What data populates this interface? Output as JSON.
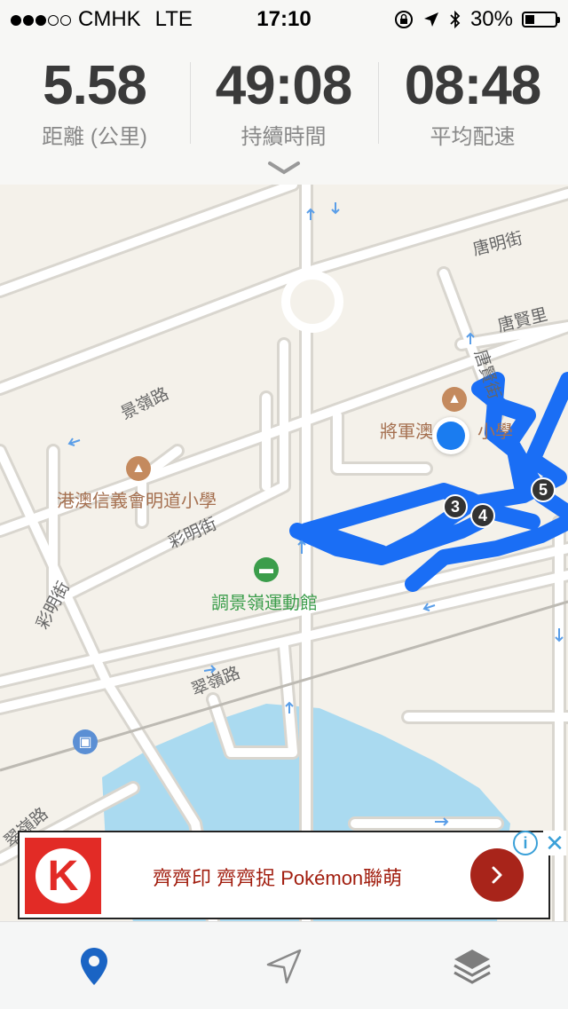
{
  "status_bar": {
    "carrier": "CMHK",
    "network": "LTE",
    "time": "17:10",
    "battery": "30%",
    "signal_dots_filled": 3,
    "signal_dots_total": 5
  },
  "stats": {
    "distance": {
      "value": "5.58",
      "label": "距離 (公里)"
    },
    "duration": {
      "value": "49:08",
      "label": "持續時間"
    },
    "pace": {
      "value": "08:48",
      "label": "平均配速"
    }
  },
  "map": {
    "pois": {
      "school_1": "將軍澳",
      "school_1b": "小學",
      "school_2": "港澳信義會明道小學",
      "sports_centre": "調景嶺運動館"
    },
    "roads": {
      "tong_ming": "唐明街",
      "tong_yin": "唐賢里",
      "tong_yin_st": "唐賢街",
      "king_ling": "景嶺路",
      "choi_ming": "彩明街",
      "choi_ming_2": "彩明街",
      "chui_ling": "翠嶺路",
      "chui_ling_2": "翠嶺路"
    },
    "markers": [
      "3",
      "4",
      "5"
    ],
    "route_color": "#1a6ef5",
    "water_color": "#aadaf0"
  },
  "ad": {
    "brand_letter": "K",
    "text": "齊齊印 齊齊捉 Pokémon聯萌",
    "info_glyph": "i",
    "close_glyph": "✕"
  },
  "tabbar": {
    "items": [
      "map-pin-icon",
      "navigation-arrow-icon",
      "layers-icon"
    ],
    "active_color": "#1a64c4"
  }
}
